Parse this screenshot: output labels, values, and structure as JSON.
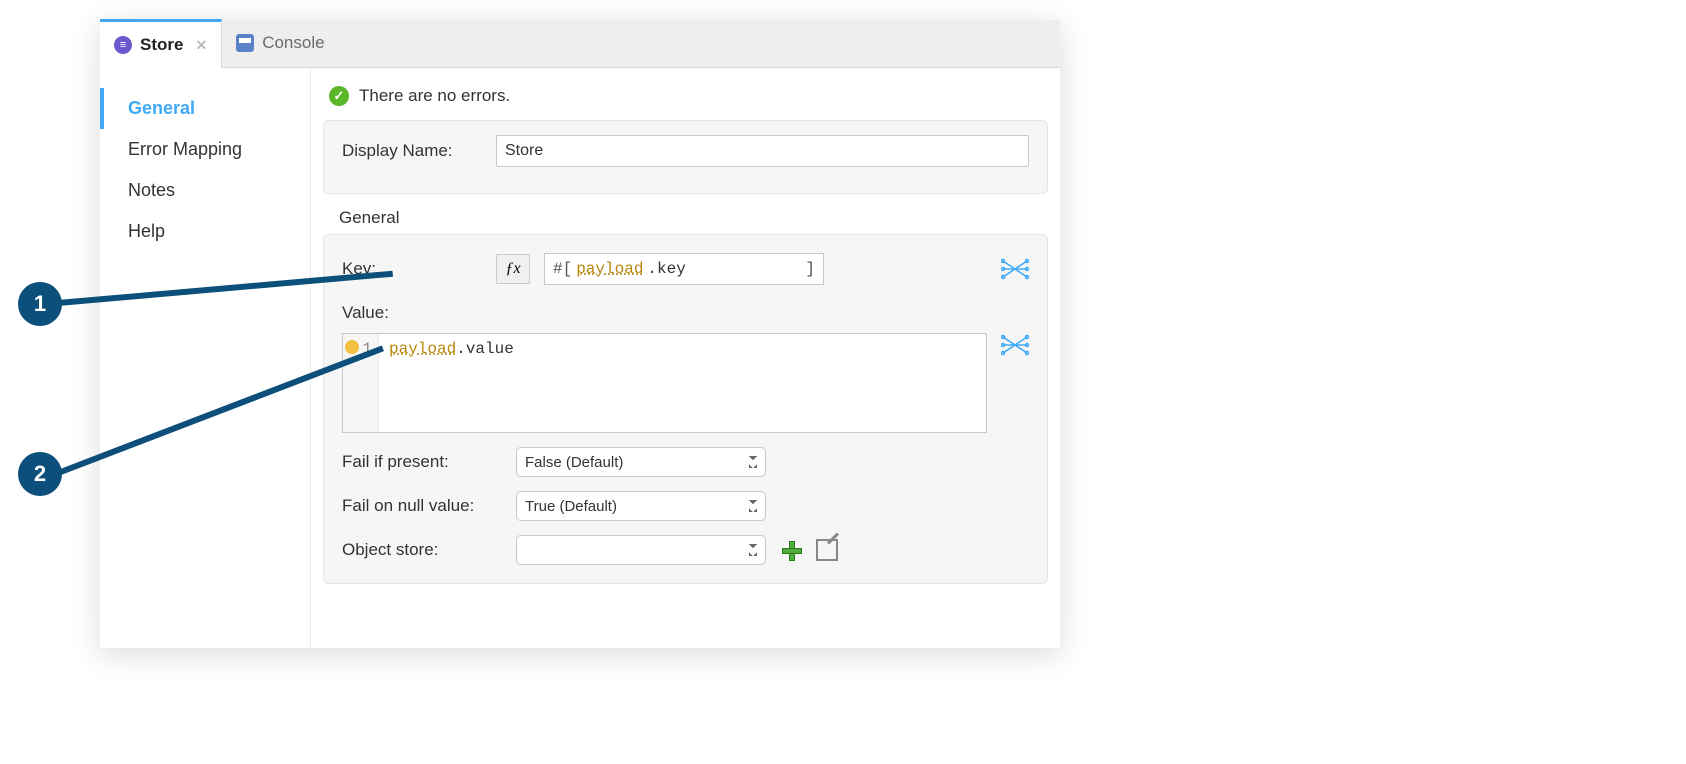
{
  "tabs": {
    "store": "Store",
    "console": "Console"
  },
  "sidebar": {
    "items": [
      "General",
      "Error Mapping",
      "Notes",
      "Help"
    ],
    "activeIndex": 0
  },
  "status": {
    "message": "There are no errors."
  },
  "form": {
    "displayNameLabel": "Display Name:",
    "displayNameValue": "Store",
    "sectionTitle": "General",
    "keyLabel": "Key:",
    "keyExprPrefix": "#[",
    "keyExprHighlighted": "payload",
    "keyExprRest": ".key",
    "keyExprSuffix": "]",
    "valueLabel": "Value:",
    "editorLine": "1",
    "editorHighlighted": "payload",
    "editorRest": ".value",
    "failIfPresentLabel": "Fail if present:",
    "failIfPresentValue": "False (Default)",
    "failOnNullLabel": "Fail on null value:",
    "failOnNullValue": "True (Default)",
    "objectStoreLabel": "Object store:",
    "objectStoreValue": ""
  },
  "callouts": {
    "one": "1",
    "two": "2"
  }
}
